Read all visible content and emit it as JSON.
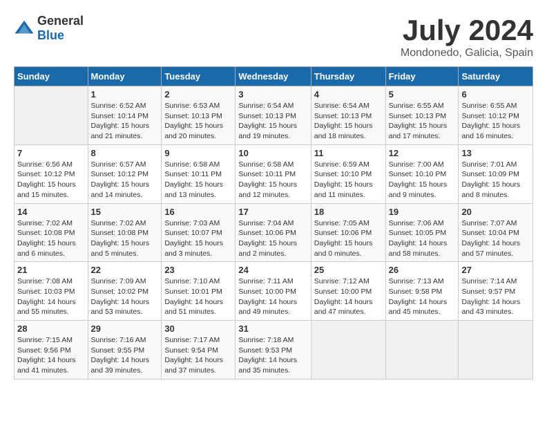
{
  "header": {
    "logo_general": "General",
    "logo_blue": "Blue",
    "month_title": "July 2024",
    "location": "Mondonedo, Galicia, Spain"
  },
  "days_of_week": [
    "Sunday",
    "Monday",
    "Tuesday",
    "Wednesday",
    "Thursday",
    "Friday",
    "Saturday"
  ],
  "weeks": [
    [
      {
        "day": "",
        "info": ""
      },
      {
        "day": "1",
        "info": "Sunrise: 6:52 AM\nSunset: 10:14 PM\nDaylight: 15 hours\nand 21 minutes."
      },
      {
        "day": "2",
        "info": "Sunrise: 6:53 AM\nSunset: 10:13 PM\nDaylight: 15 hours\nand 20 minutes."
      },
      {
        "day": "3",
        "info": "Sunrise: 6:54 AM\nSunset: 10:13 PM\nDaylight: 15 hours\nand 19 minutes."
      },
      {
        "day": "4",
        "info": "Sunrise: 6:54 AM\nSunset: 10:13 PM\nDaylight: 15 hours\nand 18 minutes."
      },
      {
        "day": "5",
        "info": "Sunrise: 6:55 AM\nSunset: 10:13 PM\nDaylight: 15 hours\nand 17 minutes."
      },
      {
        "day": "6",
        "info": "Sunrise: 6:55 AM\nSunset: 10:12 PM\nDaylight: 15 hours\nand 16 minutes."
      }
    ],
    [
      {
        "day": "7",
        "info": "Sunrise: 6:56 AM\nSunset: 10:12 PM\nDaylight: 15 hours\nand 15 minutes."
      },
      {
        "day": "8",
        "info": "Sunrise: 6:57 AM\nSunset: 10:12 PM\nDaylight: 15 hours\nand 14 minutes."
      },
      {
        "day": "9",
        "info": "Sunrise: 6:58 AM\nSunset: 10:11 PM\nDaylight: 15 hours\nand 13 minutes."
      },
      {
        "day": "10",
        "info": "Sunrise: 6:58 AM\nSunset: 10:11 PM\nDaylight: 15 hours\nand 12 minutes."
      },
      {
        "day": "11",
        "info": "Sunrise: 6:59 AM\nSunset: 10:10 PM\nDaylight: 15 hours\nand 11 minutes."
      },
      {
        "day": "12",
        "info": "Sunrise: 7:00 AM\nSunset: 10:10 PM\nDaylight: 15 hours\nand 9 minutes."
      },
      {
        "day": "13",
        "info": "Sunrise: 7:01 AM\nSunset: 10:09 PM\nDaylight: 15 hours\nand 8 minutes."
      }
    ],
    [
      {
        "day": "14",
        "info": "Sunrise: 7:02 AM\nSunset: 10:08 PM\nDaylight: 15 hours\nand 6 minutes."
      },
      {
        "day": "15",
        "info": "Sunrise: 7:02 AM\nSunset: 10:08 PM\nDaylight: 15 hours\nand 5 minutes."
      },
      {
        "day": "16",
        "info": "Sunrise: 7:03 AM\nSunset: 10:07 PM\nDaylight: 15 hours\nand 3 minutes."
      },
      {
        "day": "17",
        "info": "Sunrise: 7:04 AM\nSunset: 10:06 PM\nDaylight: 15 hours\nand 2 minutes."
      },
      {
        "day": "18",
        "info": "Sunrise: 7:05 AM\nSunset: 10:06 PM\nDaylight: 15 hours\nand 0 minutes."
      },
      {
        "day": "19",
        "info": "Sunrise: 7:06 AM\nSunset: 10:05 PM\nDaylight: 14 hours\nand 58 minutes."
      },
      {
        "day": "20",
        "info": "Sunrise: 7:07 AM\nSunset: 10:04 PM\nDaylight: 14 hours\nand 57 minutes."
      }
    ],
    [
      {
        "day": "21",
        "info": "Sunrise: 7:08 AM\nSunset: 10:03 PM\nDaylight: 14 hours\nand 55 minutes."
      },
      {
        "day": "22",
        "info": "Sunrise: 7:09 AM\nSunset: 10:02 PM\nDaylight: 14 hours\nand 53 minutes."
      },
      {
        "day": "23",
        "info": "Sunrise: 7:10 AM\nSunset: 10:01 PM\nDaylight: 14 hours\nand 51 minutes."
      },
      {
        "day": "24",
        "info": "Sunrise: 7:11 AM\nSunset: 10:00 PM\nDaylight: 14 hours\nand 49 minutes."
      },
      {
        "day": "25",
        "info": "Sunrise: 7:12 AM\nSunset: 10:00 PM\nDaylight: 14 hours\nand 47 minutes."
      },
      {
        "day": "26",
        "info": "Sunrise: 7:13 AM\nSunset: 9:58 PM\nDaylight: 14 hours\nand 45 minutes."
      },
      {
        "day": "27",
        "info": "Sunrise: 7:14 AM\nSunset: 9:57 PM\nDaylight: 14 hours\nand 43 minutes."
      }
    ],
    [
      {
        "day": "28",
        "info": "Sunrise: 7:15 AM\nSunset: 9:56 PM\nDaylight: 14 hours\nand 41 minutes."
      },
      {
        "day": "29",
        "info": "Sunrise: 7:16 AM\nSunset: 9:55 PM\nDaylight: 14 hours\nand 39 minutes."
      },
      {
        "day": "30",
        "info": "Sunrise: 7:17 AM\nSunset: 9:54 PM\nDaylight: 14 hours\nand 37 minutes."
      },
      {
        "day": "31",
        "info": "Sunrise: 7:18 AM\nSunset: 9:53 PM\nDaylight: 14 hours\nand 35 minutes."
      },
      {
        "day": "",
        "info": ""
      },
      {
        "day": "",
        "info": ""
      },
      {
        "day": "",
        "info": ""
      }
    ]
  ]
}
